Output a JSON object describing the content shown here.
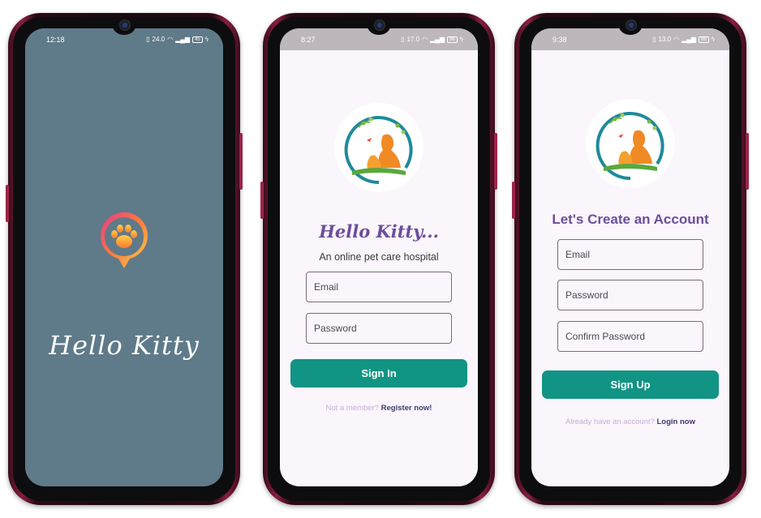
{
  "splash": {
    "status": {
      "time": "12:18",
      "speed": "24.0",
      "battery": "45"
    },
    "title": "Hello Kitty",
    "logo_icon": "paw-pin-icon"
  },
  "signin": {
    "status": {
      "time": "8:27",
      "speed": "17.0",
      "battery": "96"
    },
    "logo_icon": "pets-logo-icon",
    "title": "Hello Kitty...",
    "tagline": "An online pet care hospital",
    "email_label": "Email",
    "password_label": "Password",
    "button": "Sign In",
    "footer_prompt": "Not a member?",
    "footer_link": "Register now!"
  },
  "signup": {
    "status": {
      "time": "9:38",
      "speed": "13.0",
      "battery": "86"
    },
    "logo_icon": "pets-logo-icon",
    "title": "Let's Create an Account",
    "email_label": "Email",
    "password_label": "Password",
    "confirm_label": "Confirm Password",
    "button": "Sign Up",
    "footer_prompt": "Already have an account?",
    "footer_link": "Login now"
  },
  "colors": {
    "splash_bg": "#5f7a89",
    "screen_bg": "#fbf5fc",
    "primary": "#119484",
    "title_purple": "#6b4e9a",
    "frame": "#8a1f3e"
  }
}
